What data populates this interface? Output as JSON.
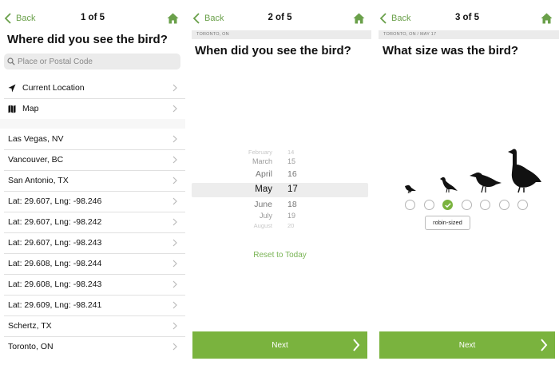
{
  "colors": {
    "accent": "#7ab33e",
    "link": "#6aa04a",
    "crumb_bg": "#ebebeb"
  },
  "panel1": {
    "back_label": "Back",
    "step": "1 of 5",
    "title": "Where did you see the bird?",
    "search_placeholder": "Place or Postal Code",
    "quick": [
      {
        "label": "Current Location",
        "icon": "location-arrow-icon"
      },
      {
        "label": "Map",
        "icon": "map-icon"
      }
    ],
    "recent": [
      "Las Vegas, NV",
      "Vancouver, BC",
      "San Antonio, TX",
      "Lat: 29.607, Lng: -98.246",
      "Lat: 29.607, Lng: -98.242",
      "Lat: 29.607, Lng: -98.243",
      "Lat: 29.608, Lng: -98.244",
      "Lat: 29.608, Lng: -98.243",
      "Lat: 29.609, Lng: -98.241",
      "Schertz, TX",
      "Toronto, ON"
    ]
  },
  "panel2": {
    "back_label": "Back",
    "step": "2 of 5",
    "breadcrumb": "TORONTO, ON",
    "title": "When did you see the bird?",
    "picker": [
      {
        "month": "February",
        "day": "14"
      },
      {
        "month": "March",
        "day": "15"
      },
      {
        "month": "April",
        "day": "16"
      },
      {
        "month": "May",
        "day": "17"
      },
      {
        "month": "June",
        "day": "18"
      },
      {
        "month": "July",
        "day": "19"
      },
      {
        "month": "August",
        "day": "20"
      }
    ],
    "selected_index": 3,
    "reset_label": "Reset to Today",
    "next_label": "Next"
  },
  "panel3": {
    "back_label": "Back",
    "step": "3 of 5",
    "breadcrumb": "TORONTO, ON  /  MAY 17",
    "title": "What size was the bird?",
    "size_count": 7,
    "selected_size_index": 2,
    "selected_size_label": "robin-sized",
    "next_label": "Next"
  }
}
